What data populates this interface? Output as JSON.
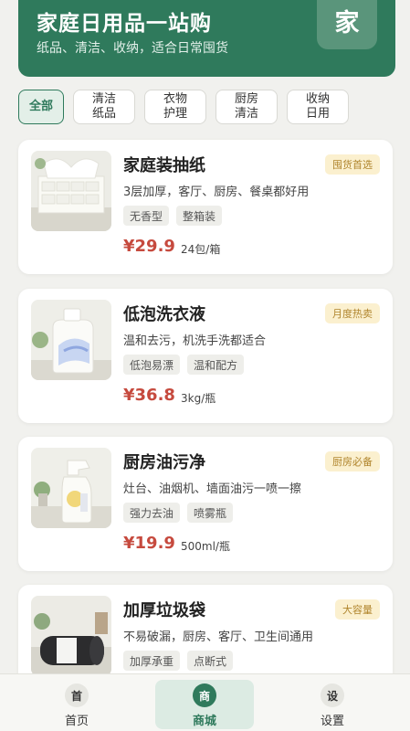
{
  "header": {
    "title": "家庭日用品一站购",
    "subtitle": "纸品、清洁、收纳，适合日常囤货",
    "badge": "家"
  },
  "categories": [
    {
      "label": "全部",
      "active": true
    },
    {
      "label": "清洁纸品",
      "active": false
    },
    {
      "label": "衣物护理",
      "active": false
    },
    {
      "label": "厨房清洁",
      "active": false
    },
    {
      "label": "收纳日用",
      "active": false
    }
  ],
  "products": [
    {
      "name": "家庭装抽纸",
      "desc": "3层加厚，客厅、厨房、餐桌都好用",
      "tags": [
        "无香型",
        "整箱装"
      ],
      "price": "¥29.9",
      "unit": "24包/箱",
      "badge": "囤货首选"
    },
    {
      "name": "低泡洗衣液",
      "desc": "温和去污，机洗手洗都适合",
      "tags": [
        "低泡易漂",
        "温和配方"
      ],
      "price": "¥36.8",
      "unit": "3kg/瓶",
      "badge": "月度热卖"
    },
    {
      "name": "厨房油污净",
      "desc": "灶台、油烟机、墙面油污一喷一擦",
      "tags": [
        "强力去油",
        "喷雾瓶"
      ],
      "price": "¥19.9",
      "unit": "500ml/瓶",
      "badge": "厨房必备"
    },
    {
      "name": "加厚垃圾袋",
      "desc": "不易破漏，厨房、客厅、卫生间通用",
      "tags": [
        "加厚承重",
        "点断式"
      ],
      "price": "",
      "unit": "",
      "badge": "大容量"
    }
  ],
  "bottom_nav": [
    {
      "icon": "首",
      "label": "首页",
      "active": false
    },
    {
      "icon": "商",
      "label": "商城",
      "active": true
    },
    {
      "icon": "设",
      "label": "设置",
      "active": false
    }
  ],
  "colors": {
    "brand": "#2f7a5c",
    "price": "#c64a3e",
    "badge_bg": "#fbf0cf"
  }
}
